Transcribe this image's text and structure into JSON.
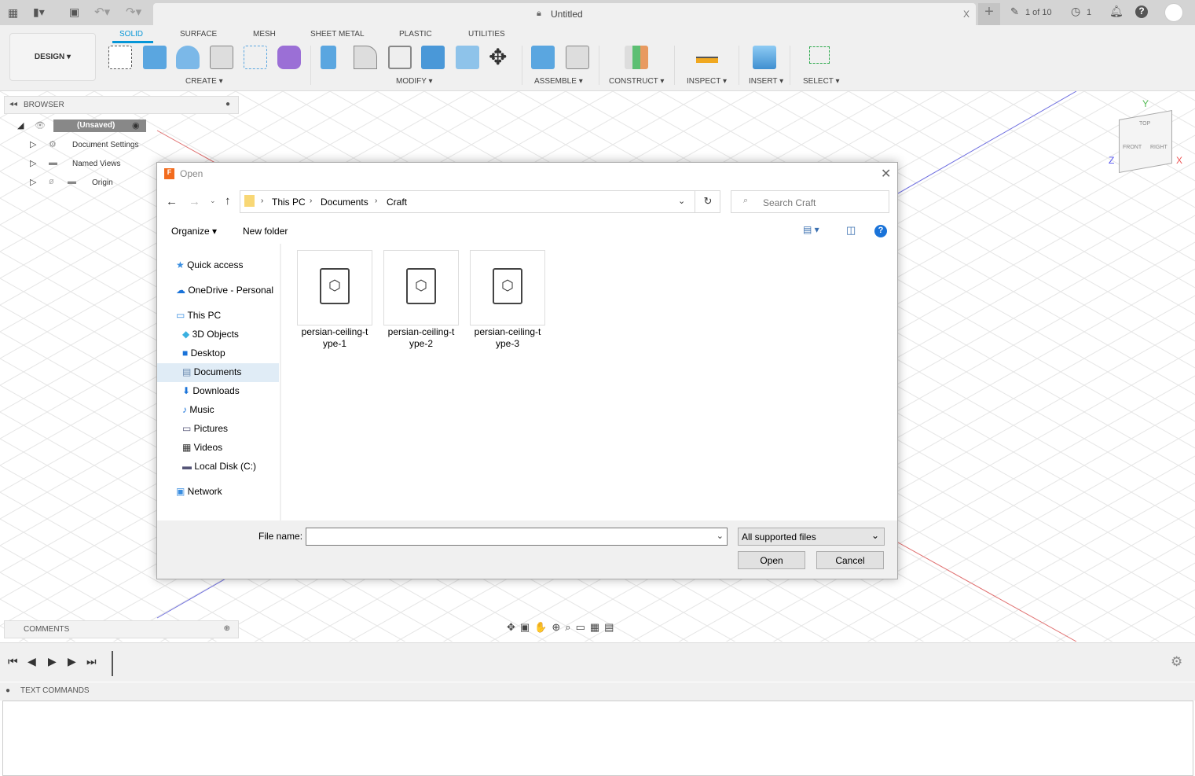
{
  "titlebar": {
    "doc_title": "Untitled",
    "jobs": "1 of 10",
    "clock_count": "1",
    "close": "X"
  },
  "ribbon": {
    "workspace": "DESIGN ▾",
    "tabs": [
      "SOLID",
      "SURFACE",
      "MESH",
      "SHEET METAL",
      "PLASTIC",
      "UTILITIES"
    ],
    "groups": [
      "CREATE ▾",
      "MODIFY ▾",
      "ASSEMBLE ▾",
      "CONSTRUCT ▾",
      "INSPECT ▾",
      "INSERT ▾",
      "SELECT ▾"
    ]
  },
  "browser": {
    "title": "BROWSER",
    "root": "(Unsaved)",
    "items": [
      "Document Settings",
      "Named Views",
      "Origin"
    ]
  },
  "comments": {
    "title": "COMMENTS"
  },
  "text_commands": {
    "title": "TEXT COMMANDS"
  },
  "viewcube": {
    "top": "TOP",
    "front": "FRONT",
    "right": "RIGHT",
    "x": "X",
    "y": "Y",
    "z": "Z"
  },
  "dialog": {
    "title": "Open",
    "breadcrumb": [
      "This PC",
      "Documents",
      "Craft"
    ],
    "search_placeholder": "Search Craft",
    "organize": "Organize ▾",
    "new_folder": "New folder",
    "nav": [
      "Quick access",
      "OneDrive - Personal",
      "This PC",
      "3D Objects",
      "Desktop",
      "Documents",
      "Downloads",
      "Music",
      "Pictures",
      "Videos",
      "Local Disk (C:)",
      "Network"
    ],
    "selected_nav": "Documents",
    "files": [
      {
        "l1": "persian-ceiling-t",
        "l2": "ype-1"
      },
      {
        "l1": "persian-ceiling-t",
        "l2": "ype-2"
      },
      {
        "l1": "persian-ceiling-t",
        "l2": "ype-3"
      }
    ],
    "file_name_label": "File name:",
    "file_name_value": "",
    "filter": "All supported files",
    "open": "Open",
    "cancel": "Cancel"
  }
}
